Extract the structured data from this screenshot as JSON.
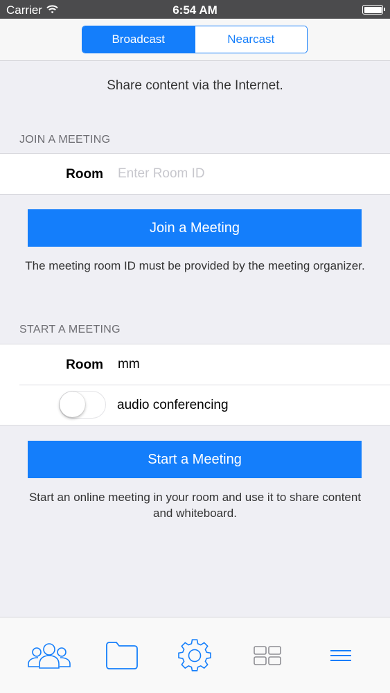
{
  "status_bar": {
    "carrier": "Carrier",
    "time": "6:54 AM"
  },
  "mode_tabs": [
    {
      "label": "Broadcast",
      "selected": true
    },
    {
      "label": "Nearcast",
      "selected": false
    }
  ],
  "subtitle": "Share content via the Internet.",
  "join": {
    "header": "JOIN A MEETING",
    "room_label": "Room",
    "room_value": "",
    "room_placeholder": "Enter Room ID",
    "button_label": "Join a Meeting",
    "helper": "The meeting room ID must be provided by the meeting organizer."
  },
  "start": {
    "header": "START A MEETING",
    "room_label": "Room",
    "room_value": "mm",
    "audio_label": "audio conferencing",
    "audio_enabled": false,
    "button_label": "Start a Meeting",
    "helper": "Start an online meeting in your room and use it to share content and whiteboard."
  },
  "tab_bar": [
    {
      "icon": "contacts-icon"
    },
    {
      "icon": "folder-icon"
    },
    {
      "icon": "gear-icon"
    },
    {
      "icon": "grid-icon"
    },
    {
      "icon": "menu-icon"
    }
  ],
  "colors": {
    "accent": "#147EFB",
    "background": "#EFEFF4",
    "status_bar": "#4B4B4D"
  }
}
